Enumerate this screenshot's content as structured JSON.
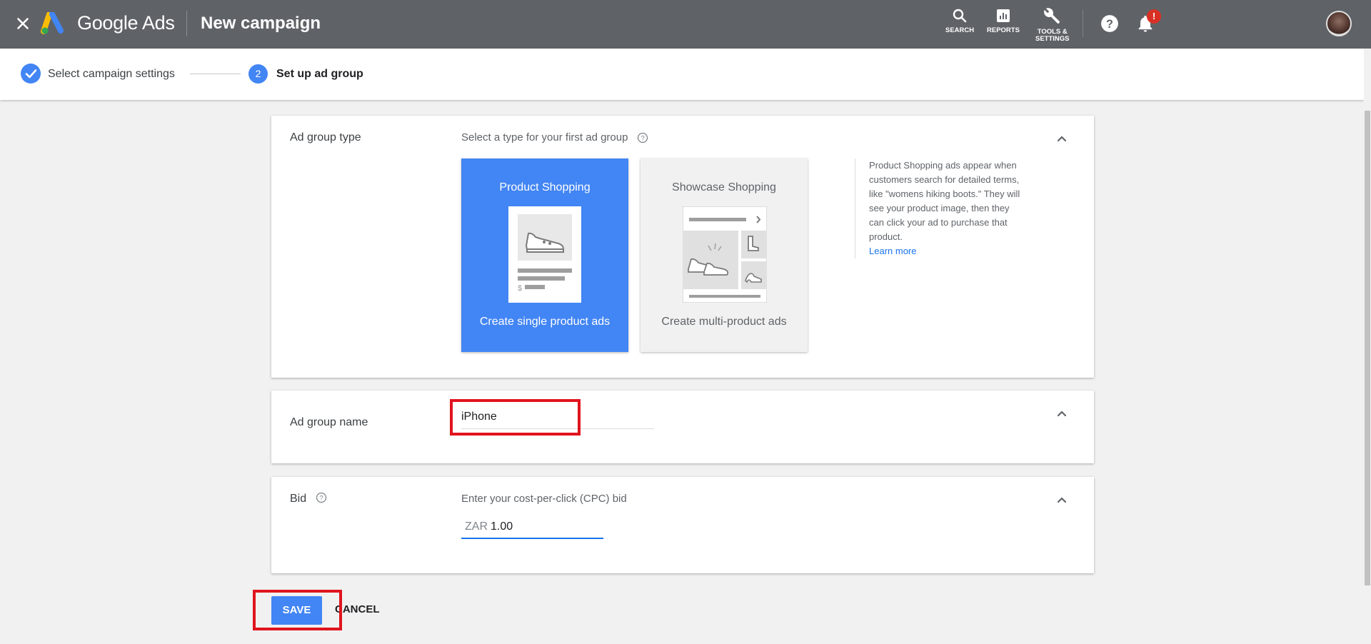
{
  "header": {
    "brand": "Google Ads",
    "title": "New campaign",
    "tools": [
      {
        "icon": "search-icon",
        "label": "SEARCH"
      },
      {
        "icon": "reports-icon",
        "label": "REPORTS"
      },
      {
        "icon": "wrench-icon",
        "label_line1": "TOOLS &",
        "label_line2": "SETTINGS"
      }
    ],
    "notification_badge": "!"
  },
  "stepper": {
    "step1": "Select campaign settings",
    "step2_number": "2",
    "step2": "Set up ad group"
  },
  "ad_group_type": {
    "label": "Ad group type",
    "prompt": "Select a type for your first ad group",
    "options": [
      {
        "title": "Product Shopping",
        "caption": "Create single product ads",
        "selected": true
      },
      {
        "title": "Showcase Shopping",
        "caption": "Create multi-product ads",
        "selected": false
      }
    ],
    "help_text": "Product Shopping ads appear when customers search for detailed terms, like \"womens hiking boots.\" They will see your product image, then they can click your ad to purchase that product.",
    "learn_more": "Learn more",
    "price_symbol": "$"
  },
  "ad_group_name": {
    "label": "Ad group name",
    "value": "iPhone"
  },
  "bid": {
    "label": "Bid",
    "prompt": "Enter your cost-per-click (CPC) bid",
    "currency": "ZAR",
    "value": "1.00"
  },
  "actions": {
    "save": "SAVE",
    "cancel": "CANCEL"
  },
  "colors": {
    "topbar": "#5f6368",
    "accent": "#4285f4",
    "highlight": "#e0141e"
  }
}
